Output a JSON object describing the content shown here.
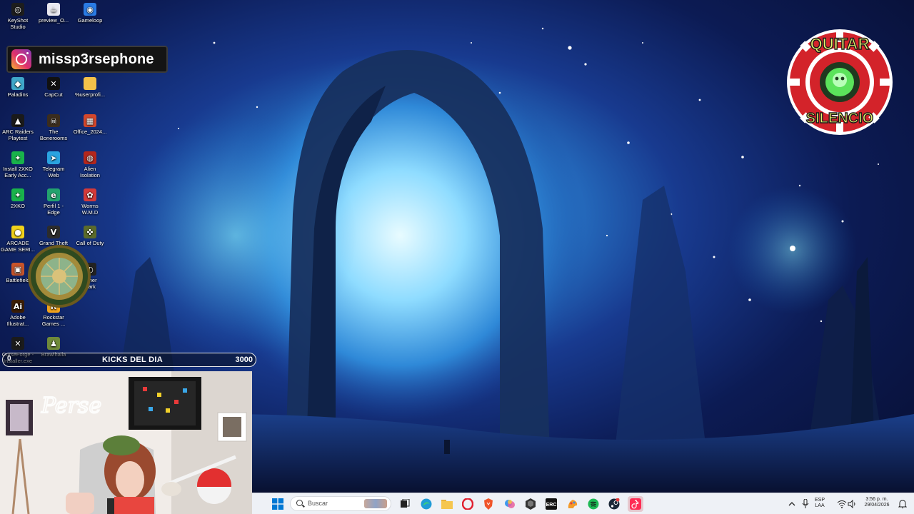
{
  "desktop_icons": [
    {
      "id": "keyshot",
      "label": "KeyShot\nStudio",
      "icon": "keyshot-icon",
      "color": "#1d1d1d",
      "glyph": "◎"
    },
    {
      "id": "preview",
      "label": "preview_O...",
      "icon": "java-file-icon",
      "color": "#e8e8f0",
      "glyph": "☕"
    },
    {
      "id": "gameloop",
      "label": "Gameloop",
      "icon": "gameloop-icon",
      "color": "#2a7be4",
      "glyph": "◉"
    },
    {
      "id": "paladins",
      "label": "Paladins",
      "icon": "paladins-icon",
      "color": "#3fa7c9",
      "glyph": "◆"
    },
    {
      "id": "capcut",
      "label": "CapCut",
      "icon": "capcut-icon",
      "color": "#111111",
      "glyph": "✕"
    },
    {
      "id": "userprofile",
      "label": "%userprofi...",
      "icon": "folder-icon",
      "color": "#f3c14a",
      "glyph": ""
    },
    {
      "id": "arcraiders",
      "label": "ARC Raiders\nPlaytest",
      "icon": "arc-raiders-icon",
      "color": "#1a1a1a",
      "glyph": "▲"
    },
    {
      "id": "boneroom",
      "label": "The\nBonerooms",
      "icon": "bonerooms-icon",
      "color": "#3b2d1e",
      "glyph": "☠"
    },
    {
      "id": "office",
      "label": "Office_2024...",
      "icon": "office-icon",
      "color": "#d4472b",
      "glyph": "▦"
    },
    {
      "id": "install2xko",
      "label": "Install 2XKO\nEarly Acc...",
      "icon": "2xko-installer-icon",
      "color": "#19b34b",
      "glyph": "✦"
    },
    {
      "id": "telegram",
      "label": "Telegram\nWeb",
      "icon": "telegram-icon",
      "color": "#2aa3e0",
      "glyph": "➤"
    },
    {
      "id": "alien",
      "label": "Alien\nIsolation",
      "icon": "alien-isolation-icon",
      "color": "#b3271c",
      "glyph": "◍"
    },
    {
      "id": "2xko",
      "label": "2XKO",
      "icon": "2xko-icon",
      "color": "#19b34b",
      "glyph": "✦"
    },
    {
      "id": "edge",
      "label": "Perfil 1 -\nEdge",
      "icon": "edge-icon",
      "color": "#23a36e",
      "glyph": "e"
    },
    {
      "id": "worms",
      "label": "Worms\nW.M.D",
      "icon": "worms-icon",
      "color": "#d33a3a",
      "glyph": "✿"
    },
    {
      "id": "arcade",
      "label": "ARCADE\nGAME SERI...",
      "icon": "pacman-icon",
      "color": "#f1d21a",
      "glyph": "●"
    },
    {
      "id": "gta",
      "label": "Grand Theft",
      "icon": "gta-icon",
      "color": "#2c2c2c",
      "glyph": "V"
    },
    {
      "id": "cod",
      "label": "Call of Duty",
      "icon": "call-of-duty-icon",
      "color": "#5b6a2b",
      "glyph": "✜"
    },
    {
      "id": "battlefield",
      "label": "Battlefield",
      "icon": "battlefield-icon",
      "color": "#c7542a",
      "glyph": "▣"
    },
    {
      "id": "darker",
      "label": "...ther\nDark",
      "icon": "dark-game-icon",
      "color": "#222222",
      "glyph": "◐"
    },
    {
      "id": "illustrator",
      "label": "Adobe\nIllustrat...",
      "icon": "illustrator-icon",
      "color": "#3b1d05",
      "glyph": "Ai"
    },
    {
      "id": "rockstar",
      "label": "Rockstar\nGames ...",
      "icon": "rockstar-icon",
      "color": "#f0a21c",
      "glyph": "R"
    },
    {
      "id": "curseforge",
      "label": "CurseForge -\nInstaller.exe",
      "icon": "curseforge-icon",
      "color": "#1b1b1b",
      "glyph": "✕"
    },
    {
      "id": "brawlhalla",
      "label": "Brawlhalla",
      "icon": "brawlhalla-icon",
      "color": "#6f8a3a",
      "glyph": "♟"
    }
  ],
  "instagram": {
    "handle": "missp3rsephone"
  },
  "mute_badge": {
    "line1": "QUITAR",
    "line2": "SILENCIO"
  },
  "kicks_bar": {
    "start": "0",
    "label": "KICKS DEL DIA",
    "goal": "3000",
    "progress": 0
  },
  "webcam": {
    "neon_sign": "Perse"
  },
  "taskbar": {
    "search_placeholder": "Buscar",
    "apps": [
      "windows-start-icon",
      "task-view-icon",
      "edge-icon",
      "file-explorer-icon",
      "opera-icon",
      "brave-icon",
      "copilot-icon",
      "unity-icon",
      "rockstar-launcher-icon",
      "paint-icon",
      "spotify-icon",
      "steam-icon",
      "tiktok-live-icon"
    ],
    "language_top": "ESP",
    "language_bottom": "LAA",
    "time": "3:56 p. m.",
    "date": "29/04/2026"
  },
  "colors": {
    "taskbar_bg": "#eef1f6",
    "accent": "#0067c0",
    "ig_gradient": "#e1306c",
    "badge_red": "#d3232a",
    "badge_green": "#5be35b"
  }
}
